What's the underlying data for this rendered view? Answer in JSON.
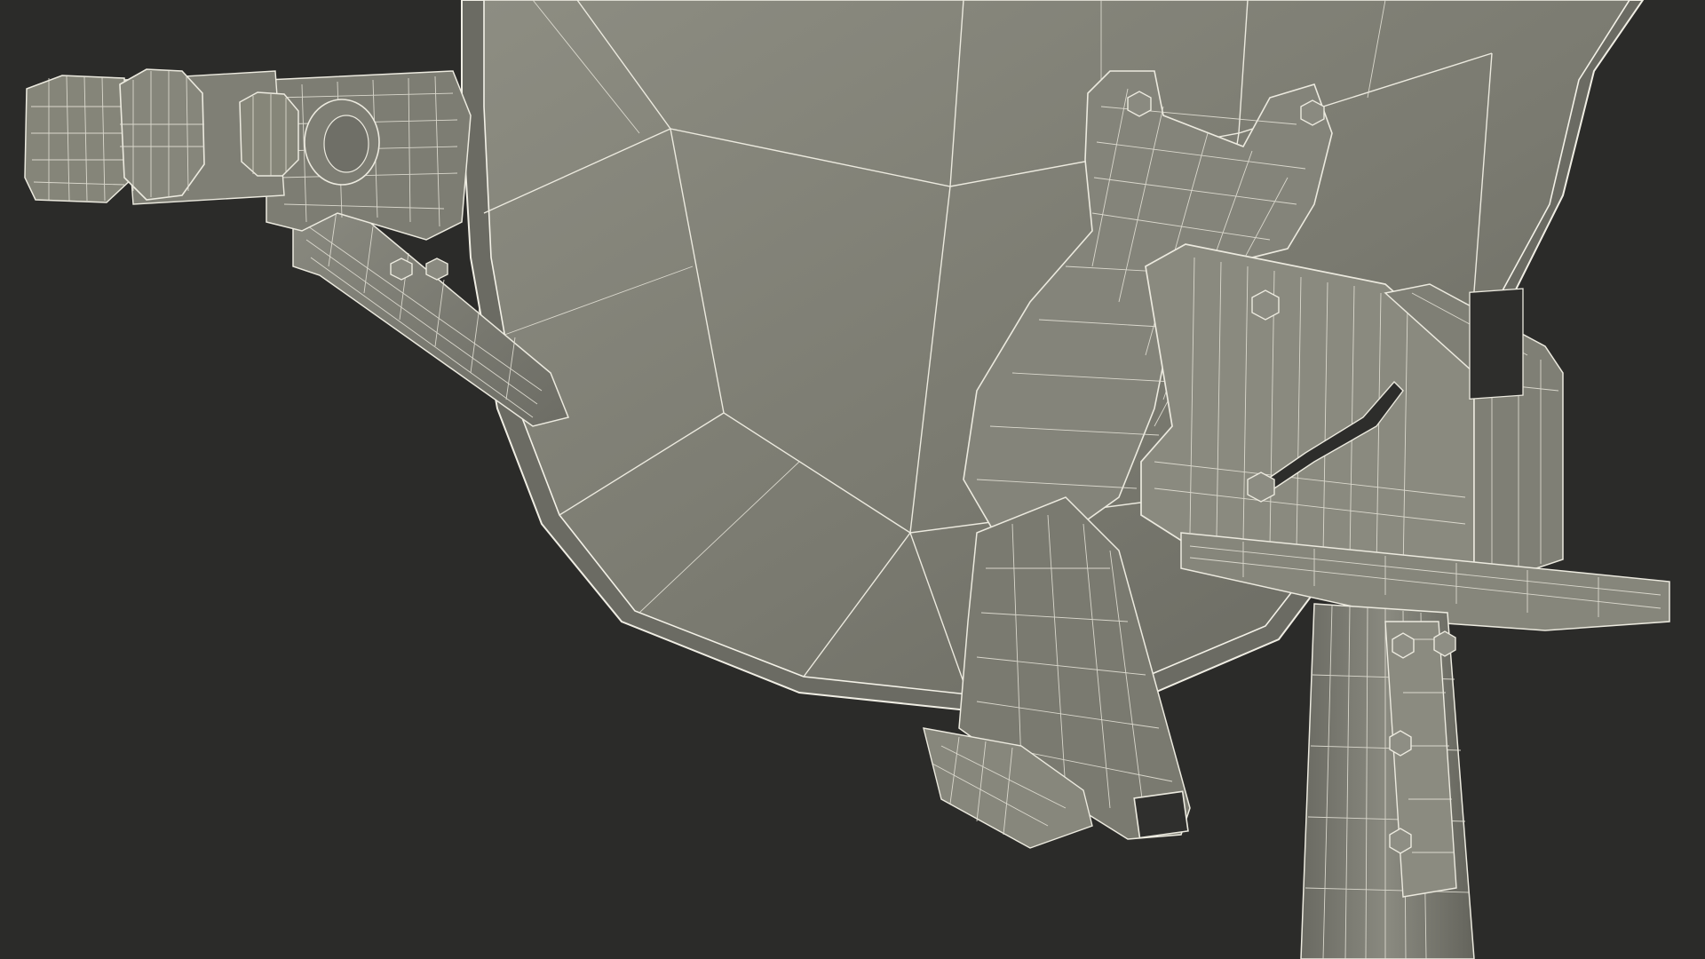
{
  "scene": {
    "subject": "satellite-dish-wireframe",
    "colors": {
      "background": "#2b2b29",
      "surface_light": "#8a8a7e",
      "surface_mid": "#73736a",
      "surface_dark": "#5e5e56",
      "wire": "#eceadf"
    }
  }
}
